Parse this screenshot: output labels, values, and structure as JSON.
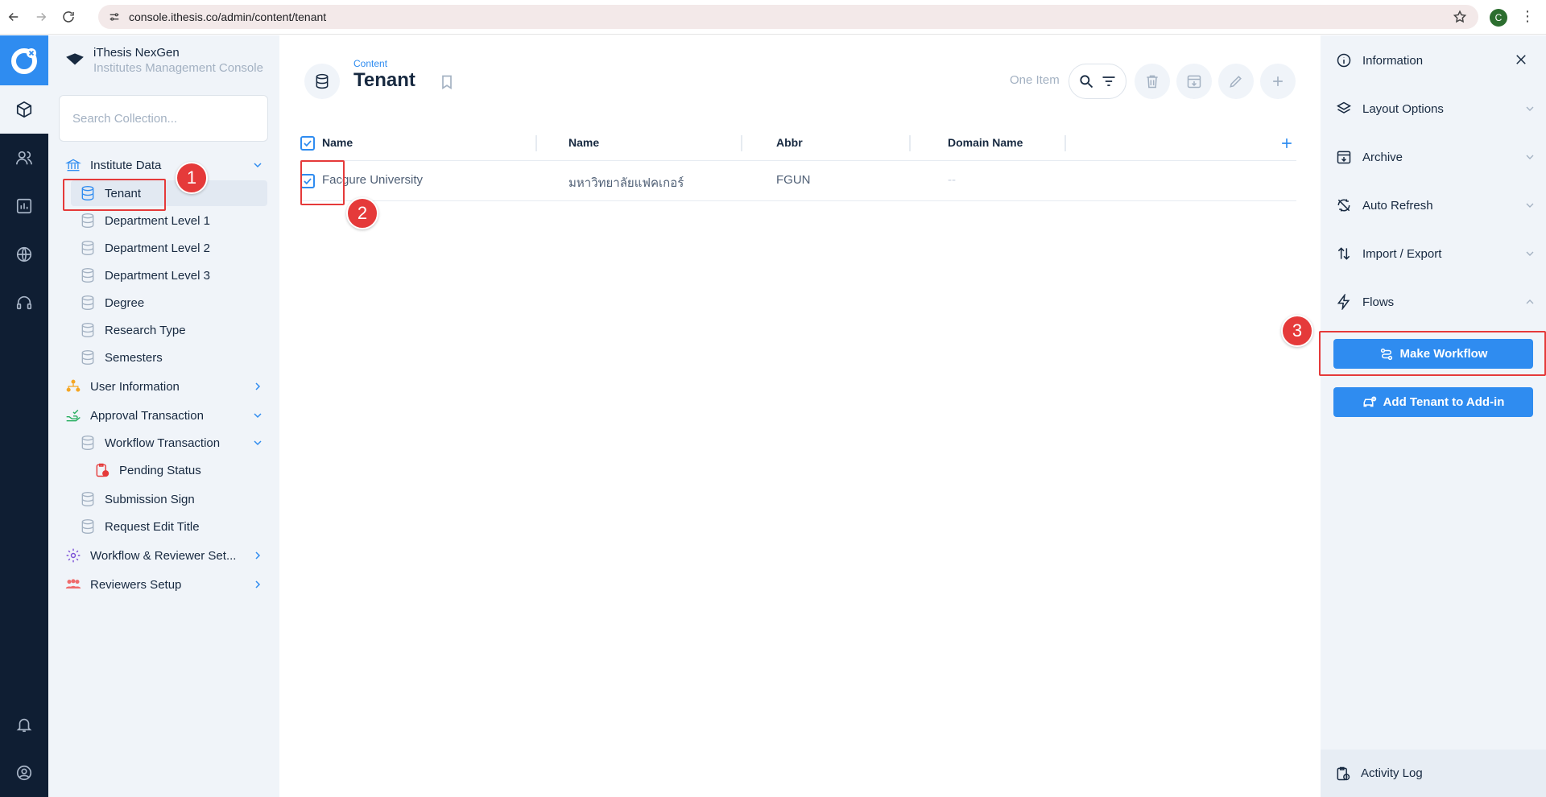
{
  "browser": {
    "url": "console.ithesis.co/admin/content/tenant",
    "profile_initial": "C",
    "menu_glyph": "⋮"
  },
  "project": {
    "name": "iThesis NexGen",
    "descriptor": "Institutes Management Console"
  },
  "nav": {
    "search_placeholder": "Search Collection...",
    "items": [
      {
        "label": "Institute Data",
        "icon": "bank-icon"
      },
      {
        "label": "Tenant",
        "icon": "database-icon"
      },
      {
        "label": "Department Level 1",
        "icon": "database-icon"
      },
      {
        "label": "Department Level 2",
        "icon": "database-icon"
      },
      {
        "label": "Department Level 3",
        "icon": "database-icon"
      },
      {
        "label": "Degree",
        "icon": "database-icon"
      },
      {
        "label": "Research Type",
        "icon": "database-icon"
      },
      {
        "label": "Semesters",
        "icon": "database-icon"
      },
      {
        "label": "User Information",
        "icon": "users-tree-icon"
      },
      {
        "label": "Approval Transaction",
        "icon": "hand-check-icon"
      },
      {
        "label": "Workflow Transaction",
        "icon": "database-icon"
      },
      {
        "label": "Pending Status",
        "icon": "clipboard-clock-icon"
      },
      {
        "label": "Submission Sign",
        "icon": "database-icon"
      },
      {
        "label": "Request Edit Title",
        "icon": "database-icon"
      },
      {
        "label": "Workflow & Reviewer Set...",
        "icon": "gear-users-icon"
      },
      {
        "label": "Reviewers Setup",
        "icon": "group-icon"
      }
    ]
  },
  "header": {
    "breadcrumb": "Content",
    "title": "Tenant",
    "item_count": "One Item"
  },
  "table": {
    "columns": [
      "Name",
      "Name",
      "Abbr",
      "Domain Name"
    ],
    "rows": [
      {
        "name_en": "Facgure University",
        "name_th": "มหาวิทยาลัยแฟคเกอร์",
        "abbr": "FGUN",
        "domain": "--"
      }
    ]
  },
  "sidebar": {
    "items": [
      {
        "label": "Information",
        "icon": "info-icon"
      },
      {
        "label": "Layout Options",
        "icon": "layers-icon"
      },
      {
        "label": "Archive",
        "icon": "archive-icon"
      },
      {
        "label": "Auto Refresh",
        "icon": "refresh-off-icon"
      },
      {
        "label": "Import / Export",
        "icon": "import-export-icon"
      },
      {
        "label": "Flows",
        "icon": "bolt-icon"
      }
    ],
    "buttons": {
      "make_workflow": "Make Workflow",
      "add_tenant": "Add Tenant to Add-in"
    },
    "activity_log": "Activity Log"
  },
  "annotations": [
    "1",
    "2",
    "3"
  ],
  "colors": {
    "accent": "#2f8cf0",
    "rail": "#0f1e33",
    "annotation": "#e53a3a"
  }
}
